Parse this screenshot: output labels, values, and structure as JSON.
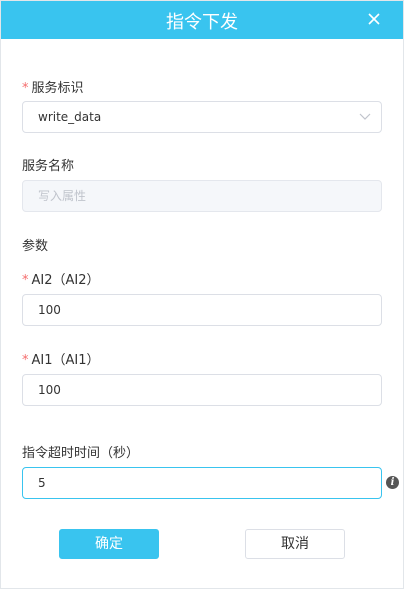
{
  "dialog": {
    "title": "指令下发",
    "close_icon": "close-icon"
  },
  "form": {
    "service_id_label": "服务标识",
    "service_id_value": "write_data",
    "service_name_label": "服务名称",
    "service_name_placeholder": "写入属性",
    "params_label": "参数",
    "ai2_label": "AI2（AI2）",
    "ai2_value": "100",
    "ai1_label": "AI1（AI1）",
    "ai1_value": "100",
    "timeout_label": "指令超时时间（秒）",
    "timeout_value": "5"
  },
  "buttons": {
    "confirm": "确定",
    "cancel": "取消"
  },
  "colors": {
    "accent": "#39c4ef",
    "required": "#f56c6c"
  }
}
